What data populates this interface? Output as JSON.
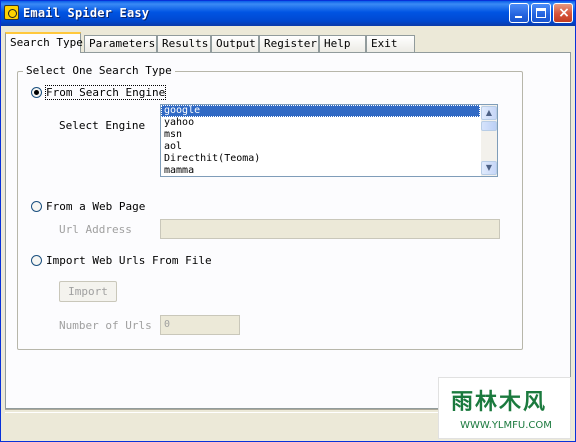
{
  "window": {
    "title": "Email Spider Easy",
    "icon": "spider-app-icon",
    "controls": {
      "minimize": "minimize-icon",
      "maximize": "maximize-icon",
      "close": "×"
    }
  },
  "tabs": [
    {
      "label": "Search Type",
      "active": true
    },
    {
      "label": "Parameters"
    },
    {
      "label": "Results"
    },
    {
      "label": "Output"
    },
    {
      "label": "Register"
    },
    {
      "label": "Help"
    },
    {
      "label": "Exit"
    }
  ],
  "search_type": {
    "group_caption": "Select One Search Type",
    "from_search_engine": {
      "label": "From Search Engine",
      "checked": true,
      "select_engine_label": "Select Engine",
      "engines": [
        "google",
        "yahoo",
        "msn",
        "aol",
        "Directhit(Teoma)",
        "mamma"
      ],
      "selected_engine": "google"
    },
    "from_web_page": {
      "label": "From a Web Page",
      "checked": false,
      "url_label": "Url Address",
      "url_value": ""
    },
    "import_file": {
      "label": "Import Web Urls From File",
      "checked": false,
      "import_button": "Import",
      "number_label": "Number of Urls",
      "number_value": "0"
    }
  },
  "watermark": {
    "logo_text": "雨林木风",
    "url_text": "WWW.YLMFU.COM"
  },
  "colors": {
    "titlebar": "#0054e3",
    "selection": "#316ac5",
    "panel": "#fcfcfe",
    "window": "#ece9d8",
    "tab_highlight": "#ffc83c",
    "watermark_green": "#1b7a3e"
  }
}
